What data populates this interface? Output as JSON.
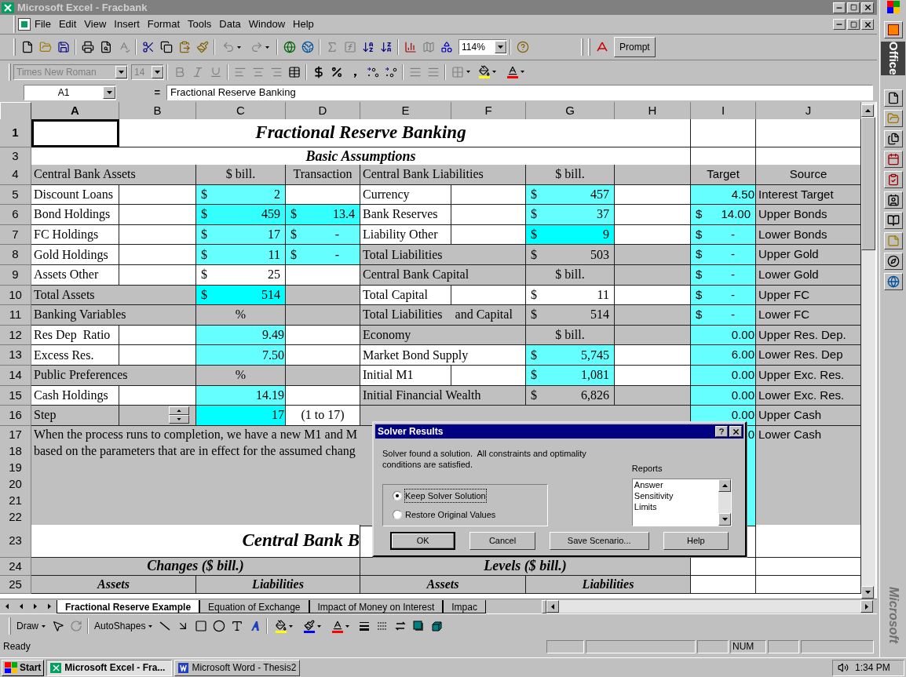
{
  "window": {
    "title": "Microsoft Excel - Fracbank"
  },
  "menu": [
    "File",
    "Edit",
    "View",
    "Insert",
    "Format",
    "Tools",
    "Data",
    "Window",
    "Help"
  ],
  "toolbar": {
    "zoom": "114%",
    "prompt": "Prompt",
    "font": "Times New Roman",
    "size": "14"
  },
  "formula_bar": {
    "name_box": "A1",
    "equals": "=",
    "formula": "Fractional Reserve Banking"
  },
  "columns": [
    {
      "label": "A",
      "selected": true
    },
    {
      "label": "B",
      "selected": false
    },
    {
      "label": "C",
      "selected": false
    },
    {
      "label": "D",
      "selected": false
    },
    {
      "label": "E",
      "selected": false
    },
    {
      "label": "F",
      "selected": false
    },
    {
      "label": "G",
      "selected": false
    },
    {
      "label": "H",
      "selected": false
    },
    {
      "label": "I",
      "selected": false
    },
    {
      "label": "J",
      "selected": false
    }
  ],
  "rows": [
    {
      "label": "1",
      "kind": "title",
      "selected": true,
      "cells": [
        {
          "kind": "title",
          "text": "Fractional Reserve Banking",
          "color": "#ffffff"
        },
        {
          "color": "#ffffff"
        },
        {
          "color": "#ffffff"
        }
      ]
    },
    {
      "label": "3",
      "kind": "section",
      "selected": false,
      "cells": [
        {
          "kind": "heading",
          "text": "Basic Assumptions",
          "color": "#ffffff"
        },
        {
          "color": "#ffffff"
        },
        {
          "color": "#ffffff"
        }
      ]
    },
    {
      "label": "4",
      "kind": "bothmerged",
      "selected": false,
      "cells": [
        {
          "kind": "label",
          "text": "Central Bank Assets",
          "color": "#c0c0c0"
        },
        {
          "kind": "center",
          "text": "$ bill.",
          "color": "#c0c0c0"
        },
        {
          "kind": "center",
          "text": "Transaction",
          "color": "#c0c0c0"
        },
        {
          "kind": "label",
          "text": "Central Bank Liabilities",
          "color": "#c0c0c0"
        },
        {
          "kind": "center",
          "text": "$ bill.",
          "color": "#c0c0c0"
        },
        {
          "color": "#c0c0c0"
        },
        {
          "kind": "center",
          "text": "Target",
          "color": "#c0c0c0"
        },
        {
          "kind": "center",
          "text": "Source",
          "color": "#c0c0c0"
        }
      ]
    },
    {
      "label": "5",
      "kind": "plain",
      "selected": false,
      "cells": [
        {
          "kind": "label",
          "text": "Discount Loans",
          "color": "#ffffff"
        },
        {
          "color": "#ffffff"
        },
        {
          "kind": "num",
          "prefix": "$",
          "text": "2",
          "color": "#66ffff"
        },
        {
          "color": "#ffffff"
        },
        {
          "kind": "label",
          "text": "Currency",
          "color": "#ffffff"
        },
        {
          "color": "#ffffff"
        },
        {
          "kind": "num",
          "prefix": "$",
          "text": "457",
          "color": "#66ffff"
        },
        {
          "color": "#ffffff"
        },
        {
          "kind": "num",
          "text": "4.50",
          "color": "#66ffff"
        },
        {
          "kind": "label",
          "text": "Interest Target",
          "color": "#c0c0c0"
        }
      ]
    },
    {
      "label": "6",
      "kind": "plain",
      "selected": false,
      "cells": [
        {
          "kind": "label",
          "text": "Bond Holdings",
          "color": "#ffffff"
        },
        {
          "color": "#ffffff"
        },
        {
          "kind": "num",
          "prefix": "$",
          "text": "459",
          "color": "#33ffff"
        },
        {
          "kind": "num",
          "prefix": "$",
          "text": "13.4",
          "color": "#33ffff"
        },
        {
          "kind": "label",
          "text": "Bank Reserves",
          "color": "#ffffff"
        },
        {
          "color": "#ffffff"
        },
        {
          "kind": "num",
          "prefix": "$",
          "text": "37",
          "color": "#66ffff"
        },
        {
          "color": "#ffffff"
        },
        {
          "kind": "num",
          "prefix": "$",
          "text": "14.00",
          "color": "#66ffff"
        },
        {
          "kind": "label",
          "text": "Upper Bonds",
          "color": "#c0c0c0"
        }
      ]
    },
    {
      "label": "7",
      "kind": "plain",
      "selected": false,
      "cells": [
        {
          "kind": "label",
          "text": "FC Holdings",
          "color": "#ffffff"
        },
        {
          "color": "#ffffff"
        },
        {
          "kind": "num",
          "prefix": "$",
          "text": "17",
          "color": "#66ffff"
        },
        {
          "kind": "dash",
          "prefix": "$",
          "text": "-",
          "color": "#66ffff"
        },
        {
          "kind": "label",
          "text": "Liability Other",
          "color": "#ffffff"
        },
        {
          "color": "#ffffff"
        },
        {
          "kind": "num",
          "prefix": "$",
          "text": "9",
          "color": "#00ffff"
        },
        {
          "color": "#ffffff"
        },
        {
          "kind": "dash",
          "prefix": "$",
          "text": "-",
          "color": "#66ffff"
        },
        {
          "kind": "label",
          "text": "Lower Bonds",
          "color": "#c0c0c0"
        }
      ]
    },
    {
      "label": "8",
      "kind": "rightmerged",
      "selected": false,
      "cells": [
        {
          "kind": "label",
          "text": "Gold Holdings",
          "color": "#ffffff"
        },
        {
          "color": "#ffffff"
        },
        {
          "kind": "num",
          "prefix": "$",
          "text": "11",
          "color": "#66ffff"
        },
        {
          "kind": "dash",
          "prefix": "$",
          "text": "-",
          "color": "#66ffff"
        },
        {
          "kind": "label",
          "text": "Total Liabilities",
          "color": "#c0c0c0"
        },
        {
          "kind": "num",
          "prefix": "$",
          "text": "503",
          "color": "#c0c0c0"
        },
        {
          "color": "#c0c0c0"
        },
        {
          "kind": "dash",
          "prefix": "$",
          "text": "-",
          "color": "#66ffff"
        },
        {
          "kind": "label",
          "text": "Upper Gold",
          "color": "#c0c0c0"
        }
      ]
    },
    {
      "label": "9",
      "kind": "rightmerged",
      "selected": false,
      "cells": [
        {
          "kind": "label",
          "text": "Assets Other",
          "color": "#ffffff"
        },
        {
          "color": "#ffffff"
        },
        {
          "kind": "num",
          "prefix": "$",
          "text": "25",
          "color": "#ffffff"
        },
        {
          "color": "#ffffff"
        },
        {
          "kind": "label",
          "text": "Central Bank Capital",
          "color": "#c0c0c0"
        },
        {
          "kind": "center",
          "text": "$ bill.",
          "color": "#c0c0c0"
        },
        {
          "color": "#c0c0c0"
        },
        {
          "kind": "dash",
          "prefix": "$",
          "text": "-",
          "color": "#66ffff"
        },
        {
          "kind": "label",
          "text": "Lower Gold",
          "color": "#c0c0c0"
        }
      ]
    },
    {
      "label": "10",
      "kind": "leftmerged",
      "selected": false,
      "cells": [
        {
          "kind": "label",
          "text": "Total Assets",
          "color": "#c0c0c0"
        },
        {
          "kind": "num",
          "prefix": "$",
          "text": "514",
          "color": "#00ffff"
        },
        {
          "color": "#c0c0c0"
        },
        {
          "kind": "label",
          "text": "Total Capital",
          "color": "#ffffff"
        },
        {
          "color": "#ffffff"
        },
        {
          "kind": "num",
          "prefix": "$",
          "text": "11",
          "color": "#ffffff"
        },
        {
          "color": "#ffffff"
        },
        {
          "kind": "dash",
          "prefix": "$",
          "text": "-",
          "color": "#66ffff"
        },
        {
          "kind": "label",
          "text": "Upper FC",
          "color": "#c0c0c0"
        }
      ]
    },
    {
      "label": "11",
      "kind": "bothmerged",
      "selected": false,
      "cells": [
        {
          "kind": "label",
          "text": "Banking Variables",
          "color": "#c0c0c0"
        },
        {
          "kind": "center",
          "text": "%",
          "color": "#c0c0c0"
        },
        {
          "color": "#c0c0c0"
        },
        {
          "kind": "label",
          "text": "Total Liabilities    and Capital",
          "color": "#c0c0c0"
        },
        {
          "kind": "num",
          "prefix": "$",
          "text": "514",
          "color": "#c0c0c0"
        },
        {
          "color": "#c0c0c0"
        },
        {
          "kind": "dash",
          "prefix": "$",
          "text": "-",
          "color": "#66ffff"
        },
        {
          "kind": "label",
          "text": "Lower FC",
          "color": "#c0c0c0"
        }
      ]
    },
    {
      "label": "12",
      "kind": "rightmerged",
      "selected": false,
      "cells": [
        {
          "kind": "label",
          "text": "Res Dep  Ratio",
          "color": "#ffffff"
        },
        {
          "color": "#ffffff"
        },
        {
          "kind": "num",
          "text": "9.49",
          "color": "#66ffff"
        },
        {
          "color": "#ffffff"
        },
        {
          "kind": "label",
          "text": "Economy",
          "color": "#c0c0c0"
        },
        {
          "kind": "center",
          "text": "$ bill.",
          "color": "#c0c0c0"
        },
        {
          "color": "#c0c0c0"
        },
        {
          "kind": "num",
          "text": "0.00",
          "color": "#66ffff"
        },
        {
          "kind": "label",
          "text": "Upper Res. Dep.",
          "color": "#c0c0c0"
        }
      ]
    },
    {
      "label": "13",
      "kind": "rightmerged",
      "selected": false,
      "cells": [
        {
          "kind": "label",
          "text": "Excess Res.",
          "color": "#ffffff"
        },
        {
          "color": "#ffffff"
        },
        {
          "kind": "num",
          "text": "7.50",
          "color": "#66ffff"
        },
        {
          "color": "#ffffff"
        },
        {
          "kind": "label",
          "text": "Market Bond Supply",
          "color": "#ffffff"
        },
        {
          "kind": "num",
          "prefix": "$",
          "text": "5,745",
          "color": "#66ffff"
        },
        {
          "color": "#ffffff"
        },
        {
          "kind": "num",
          "text": "6.00",
          "color": "#66ffff"
        },
        {
          "kind": "label",
          "text": "Lower Res. Dep",
          "color": "#c0c0c0"
        }
      ]
    },
    {
      "label": "14",
      "kind": "leftmerged",
      "selected": false,
      "cells": [
        {
          "kind": "label",
          "text": "Public Preferences",
          "color": "#c0c0c0"
        },
        {
          "kind": "center",
          "text": "%",
          "color": "#c0c0c0"
        },
        {
          "color": "#c0c0c0"
        },
        {
          "kind": "label",
          "text": "Initial M1",
          "color": "#ffffff"
        },
        {
          "color": "#ffffff"
        },
        {
          "kind": "num",
          "prefix": "$",
          "text": "1,081",
          "color": "#66ffff"
        },
        {
          "color": "#ffffff"
        },
        {
          "kind": "num",
          "text": "0.00",
          "color": "#66ffff"
        },
        {
          "kind": "label",
          "text": "Upper Exc. Res.",
          "color": "#c0c0c0"
        }
      ]
    },
    {
      "label": "15",
      "kind": "rightmerged",
      "selected": false,
      "cells": [
        {
          "kind": "label",
          "text": "Cash Holdings",
          "color": "#ffffff"
        },
        {
          "color": "#ffffff"
        },
        {
          "kind": "num",
          "text": "14.19",
          "color": "#66ffff"
        },
        {
          "color": "#ffffff"
        },
        {
          "kind": "label",
          "text": "Initial Financial Wealth",
          "color": "#c0c0c0"
        },
        {
          "kind": "num",
          "prefix": "$",
          "text": "6,826",
          "color": "#c0c0c0"
        },
        {
          "color": "#c0c0c0"
        },
        {
          "kind": "num",
          "text": "0.00",
          "color": "#66ffff"
        },
        {
          "kind": "label",
          "text": "Lower Exc. Res.",
          "color": "#c0c0c0"
        }
      ]
    },
    {
      "label": "16",
      "kind": "step",
      "selected": false,
      "cells": [
        {
          "kind": "label",
          "text": "Step",
          "color": "#c0c0c0"
        },
        {
          "kind": "spinner",
          "color": "#c0c0c0"
        },
        {
          "kind": "num",
          "text": "17",
          "color": "#00ffff"
        },
        {
          "kind": "center",
          "text": "(1 to 17)",
          "color": "#ffffff"
        },
        {
          "color": "#c0c0c0"
        },
        {
          "kind": "num",
          "text": "0.00",
          "color": "#66ffff"
        },
        {
          "kind": "label",
          "text": "Upper Cash",
          "color": "#c0c0c0"
        }
      ]
    },
    {
      "label": "17",
      "kind": "text",
      "selected": false,
      "cells": [
        {
          "kind": "note",
          "text": "When the process runs to completion, we have a new M1 and M",
          "color": "#c0c0c0"
        },
        {
          "kind": "num",
          "text": "0",
          "color": "#66ffff"
        },
        {
          "kind": "label",
          "text": "Lower Cash",
          "color": "#c0c0c0"
        }
      ]
    },
    {
      "label": "18",
      "kind": "text",
      "selected": false,
      "cells": [
        {
          "kind": "note",
          "text": "based on the parameters that are in effect for the assumed chang",
          "color": "#c0c0c0"
        },
        {
          "color": "#66ffff"
        },
        {
          "color": "#c0c0c0"
        }
      ]
    },
    {
      "label": "19",
      "kind": "text",
      "selected": false,
      "cells": [
        {
          "color": "#c0c0c0"
        },
        {
          "color": "#66ffff"
        },
        {
          "color": "#c0c0c0"
        }
      ]
    },
    {
      "label": "20",
      "kind": "text",
      "selected": false,
      "cells": [
        {
          "color": "#c0c0c0"
        },
        {
          "color": "#66ffff"
        },
        {
          "color": "#c0c0c0"
        }
      ]
    },
    {
      "label": "21",
      "kind": "text",
      "selected": false,
      "cells": [
        {
          "color": "#c0c0c0"
        },
        {
          "color": "#66ffff"
        },
        {
          "color": "#c0c0c0"
        }
      ]
    },
    {
      "label": "22",
      "kind": "text",
      "selected": false,
      "cells": [
        {
          "color": "#c0c0c0"
        },
        {
          "color": "#66ffff"
        },
        {
          "color": "#c0c0c0"
        }
      ]
    },
    {
      "label": "23",
      "kind": "banner",
      "selected": false,
      "cells": [
        {
          "kind": "title-right",
          "text": "Central Bank B",
          "color": "#ffffff"
        },
        {
          "kind": "blank"
        },
        {
          "kind": "blank"
        },
        {
          "color": "#ffffff"
        }
      ]
    },
    {
      "label": "24",
      "kind": "header",
      "selected": false,
      "cells": [
        {
          "kind": "heading",
          "text": "Changes ($ bill.)",
          "color": "#c0c0c0"
        },
        {
          "kind": "heading",
          "text": "Levels ($ bill.)",
          "color": "#c0c0c0"
        },
        {
          "color": "#ffffff"
        },
        {
          "color": "#ffffff"
        }
      ]
    },
    {
      "label": "25",
      "kind": "subheader",
      "selected": false,
      "cells": [
        {
          "kind": "subheading",
          "text": "Assets",
          "color": "#c0c0c0"
        },
        {
          "kind": "subheading",
          "text": "Liabilities",
          "color": "#c0c0c0"
        },
        {
          "kind": "subheading",
          "text": "Assets",
          "color": "#c0c0c0"
        },
        {
          "kind": "subheading",
          "text": "Liabilities",
          "color": "#c0c0c0"
        },
        {
          "color": "#ffffff"
        },
        {
          "color": "#ffffff"
        }
      ]
    }
  ],
  "sheet_tabs": [
    {
      "label": "Fractional Reserve Example",
      "selected": true
    },
    {
      "label": "Equation of Exchange",
      "selected": false
    },
    {
      "label": "Impact of Money on Interest",
      "selected": false
    },
    {
      "label": "Impac",
      "selected": false
    }
  ],
  "drawing_toolbar": {
    "draw": "Draw",
    "autoshapes": "AutoShapes"
  },
  "status_bar": {
    "status": "Ready",
    "indicator": "NUM"
  },
  "dialog": {
    "title": "Solver Results",
    "message": "Solver found a solution.  All constraints and optimality conditions are satisfied.",
    "options": [
      {
        "label": "Keep Solver Solution",
        "selected": true
      },
      {
        "label": "Restore Original Values",
        "selected": false
      }
    ],
    "reports_label": "Reports",
    "reports": [
      "Answer",
      "Sensitivity",
      "Limits"
    ],
    "buttons": [
      "OK",
      "Cancel",
      "Save Scenario...",
      "Help"
    ]
  },
  "office_bar": {
    "title": "Office",
    "brand": "Microsoft"
  },
  "taskbar": {
    "start": "Start",
    "tasks": [
      {
        "label": "Microsoft Excel - Fra...",
        "selected": true
      },
      {
        "label": "Microsoft Word - Thesis2",
        "selected": false
      }
    ],
    "clock": "1:34 PM"
  }
}
